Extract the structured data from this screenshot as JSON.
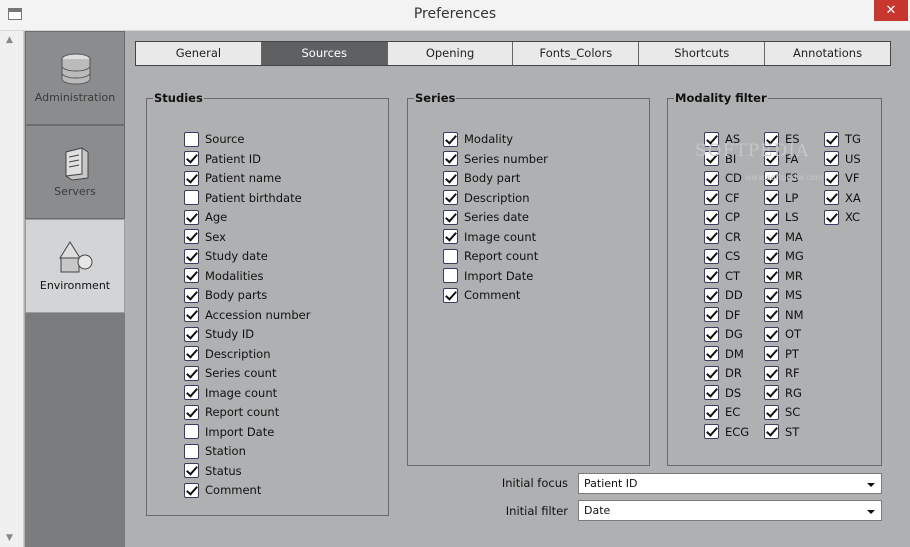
{
  "window": {
    "title": "Preferences",
    "close_glyph": "✕"
  },
  "nav": [
    {
      "label": "Administration",
      "icon": "database-icon"
    },
    {
      "label": "Servers",
      "icon": "server-icon"
    },
    {
      "label": "Environment",
      "icon": "shapes-icon",
      "active": true
    }
  ],
  "tabs": [
    {
      "label": "General"
    },
    {
      "label": "Sources",
      "active": true
    },
    {
      "label": "Opening"
    },
    {
      "label": "Fonts_Colors"
    },
    {
      "label": "Shortcuts"
    },
    {
      "label": "Annotations"
    }
  ],
  "studies": {
    "title": "Studies",
    "items": [
      {
        "label": "Source",
        "checked": false
      },
      {
        "label": "Patient ID",
        "checked": true
      },
      {
        "label": "Patient name",
        "checked": true
      },
      {
        "label": "Patient birthdate",
        "checked": false
      },
      {
        "label": "Age",
        "checked": true
      },
      {
        "label": "Sex",
        "checked": true
      },
      {
        "label": "Study date",
        "checked": true
      },
      {
        "label": "Modalities",
        "checked": true
      },
      {
        "label": "Body parts",
        "checked": true
      },
      {
        "label": "Accession number",
        "checked": true
      },
      {
        "label": "Study ID",
        "checked": true
      },
      {
        "label": "Description",
        "checked": true
      },
      {
        "label": "Series count",
        "checked": true
      },
      {
        "label": "Image count",
        "checked": true
      },
      {
        "label": "Report count",
        "checked": true
      },
      {
        "label": "Import Date",
        "checked": false
      },
      {
        "label": "Station",
        "checked": false
      },
      {
        "label": "Status",
        "checked": true
      },
      {
        "label": "Comment",
        "checked": true
      }
    ]
  },
  "series": {
    "title": "Series",
    "items": [
      {
        "label": "Modality",
        "checked": true
      },
      {
        "label": "Series number",
        "checked": true
      },
      {
        "label": "Body part",
        "checked": true
      },
      {
        "label": "Description",
        "checked": true
      },
      {
        "label": "Series date",
        "checked": true
      },
      {
        "label": "Image count",
        "checked": true
      },
      {
        "label": "Report count",
        "checked": false
      },
      {
        "label": "Import Date",
        "checked": false
      },
      {
        "label": "Comment",
        "checked": true
      }
    ]
  },
  "modality": {
    "title": "Modality filter",
    "columns": [
      [
        "AS",
        "BI",
        "CD",
        "CF",
        "CP",
        "CR",
        "CS",
        "CT",
        "DD",
        "DF",
        "DG",
        "DM",
        "DR",
        "DS",
        "EC",
        "ECG"
      ],
      [
        "ES",
        "FA",
        "FS",
        "LP",
        "LS",
        "MA",
        "MG",
        "MR",
        "MS",
        "NM",
        "OT",
        "PT",
        "RF",
        "RG",
        "SC",
        "ST"
      ],
      [
        "TG",
        "US",
        "VF",
        "XA",
        "XC"
      ]
    ]
  },
  "initial_focus": {
    "label": "Initial focus",
    "value": "Patient ID"
  },
  "initial_filter": {
    "label": "Initial filter",
    "value": "Date"
  },
  "watermark": {
    "text": "SOFTPEDIA",
    "sub": "www.softpedia.com"
  }
}
